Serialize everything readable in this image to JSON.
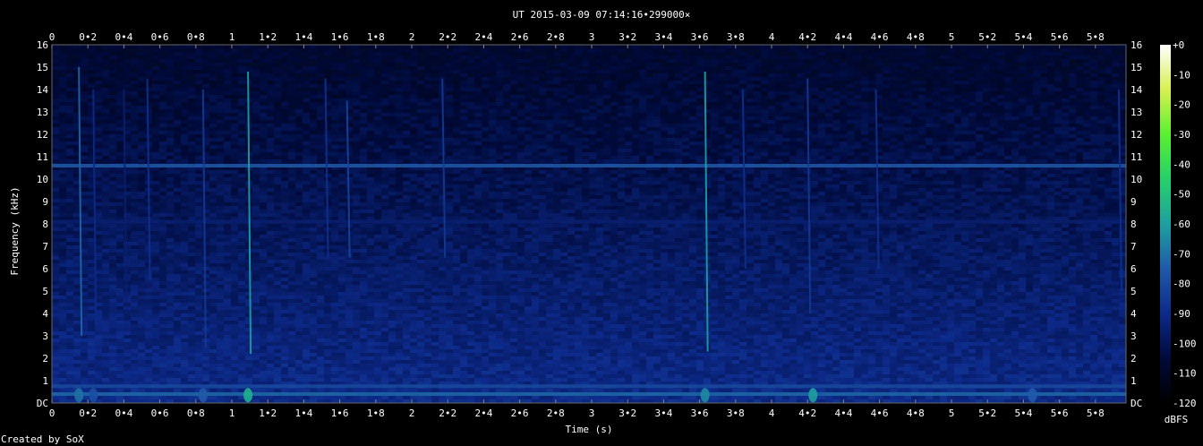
{
  "chart_data": {
    "type": "heatmap",
    "title": "UT 2015-03-09 07:14:16•299000×",
    "xlabel": "Time (s)",
    "ylabel": "Frequency (kHz)",
    "colorbar_label": "dBFS",
    "footer": "Created by SoX",
    "xlim": [
      0,
      5.97
    ],
    "ylim": [
      0,
      16
    ],
    "x_ticks": [
      "0",
      "0•2",
      "0•4",
      "0•6",
      "0•8",
      "1",
      "1•2",
      "1•4",
      "1•6",
      "1•8",
      "2",
      "2•2",
      "2•4",
      "2•6",
      "2•8",
      "3",
      "3•2",
      "3•4",
      "3•6",
      "3•8",
      "4",
      "4•2",
      "4•4",
      "4•6",
      "4•8",
      "5",
      "5•2",
      "5•4",
      "5•6",
      "5•8"
    ],
    "y_ticks": [
      "DC",
      "1",
      "2",
      "3",
      "4",
      "5",
      "6",
      "7",
      "8",
      "9",
      "10",
      "11",
      "12",
      "13",
      "14",
      "15",
      "16"
    ],
    "colorbar_ticks": [
      "+0",
      "-10",
      "-20",
      "-30",
      "-40",
      "-50",
      "-60",
      "-70",
      "-80",
      "-90",
      "-100",
      "-110",
      "-120"
    ],
    "colorbar_range": [
      -120,
      0
    ],
    "colormap": [
      "#000000",
      "#000a3a",
      "#0d2a8a",
      "#1f5aa8",
      "#1fa0a0",
      "#26d06a",
      "#5af032",
      "#d8f050",
      "#ffffff"
    ],
    "tones": [
      {
        "freq_khz": 10.6,
        "level_dbfs": -75
      },
      {
        "freq_khz": 8.1,
        "level_dbfs": -95
      },
      {
        "freq_khz": 0.4,
        "level_dbfs": -72
      },
      {
        "freq_khz": 0.75,
        "level_dbfs": -80
      }
    ],
    "transients": [
      {
        "time_s": 0.15,
        "fmin_khz": 3.0,
        "fmax_khz": 15.0,
        "level_dbfs": -72
      },
      {
        "time_s": 0.23,
        "fmin_khz": 3.5,
        "fmax_khz": 14.0,
        "level_dbfs": -90
      },
      {
        "time_s": 0.4,
        "fmin_khz": 4.0,
        "fmax_khz": 14.0,
        "level_dbfs": -95
      },
      {
        "time_s": 0.53,
        "fmin_khz": 5.5,
        "fmax_khz": 14.5,
        "level_dbfs": -88
      },
      {
        "time_s": 0.84,
        "fmin_khz": 2.5,
        "fmax_khz": 14.0,
        "level_dbfs": -85
      },
      {
        "time_s": 1.09,
        "fmin_khz": 2.2,
        "fmax_khz": 14.8,
        "level_dbfs": -60
      },
      {
        "time_s": 1.52,
        "fmin_khz": 6.5,
        "fmax_khz": 14.5,
        "level_dbfs": -88
      },
      {
        "time_s": 1.64,
        "fmin_khz": 6.5,
        "fmax_khz": 13.5,
        "level_dbfs": -82
      },
      {
        "time_s": 2.17,
        "fmin_khz": 6.5,
        "fmax_khz": 14.5,
        "level_dbfs": -85
      },
      {
        "time_s": 3.63,
        "fmin_khz": 2.3,
        "fmax_khz": 14.8,
        "level_dbfs": -60
      },
      {
        "time_s": 3.84,
        "fmin_khz": 6.0,
        "fmax_khz": 14.0,
        "level_dbfs": -88
      },
      {
        "time_s": 4.2,
        "fmin_khz": 4.0,
        "fmax_khz": 14.5,
        "level_dbfs": -85
      },
      {
        "time_s": 4.58,
        "fmin_khz": 6.0,
        "fmax_khz": 14.0,
        "level_dbfs": -88
      },
      {
        "time_s": 5.93,
        "fmin_khz": 5.0,
        "fmax_khz": 14.0,
        "level_dbfs": -88
      }
    ],
    "low_bursts": [
      {
        "time_s": 0.15,
        "level_dbfs": -70
      },
      {
        "time_s": 0.23,
        "level_dbfs": -78
      },
      {
        "time_s": 0.84,
        "level_dbfs": -75
      },
      {
        "time_s": 1.09,
        "level_dbfs": -55
      },
      {
        "time_s": 3.63,
        "level_dbfs": -65
      },
      {
        "time_s": 4.23,
        "level_dbfs": -60
      },
      {
        "time_s": 5.45,
        "level_dbfs": -75
      }
    ]
  }
}
